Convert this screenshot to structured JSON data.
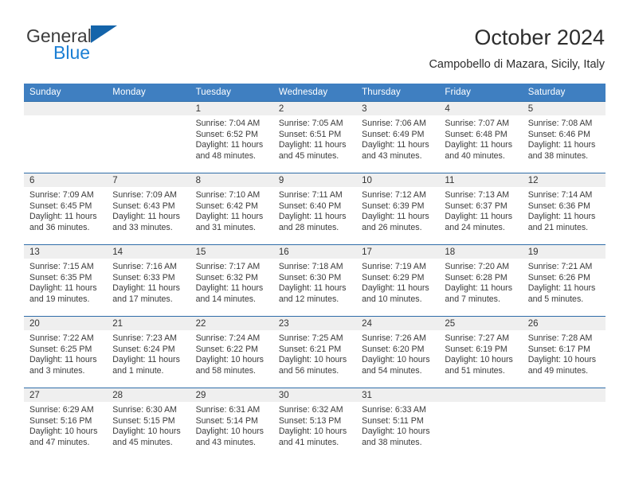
{
  "logo": {
    "name_top": "General",
    "name_bottom": "Blue",
    "triangle_color": "#1464aa",
    "blue_text_color": "#1b7fd4"
  },
  "header": {
    "title": "October 2024",
    "subtitle": "Campobello di Mazara, Sicily, Italy"
  },
  "colors": {
    "header_row": "#3f7fc1",
    "row_border": "#2f6da8",
    "daynum_band": "#efefef",
    "text": "#3a3a3a"
  },
  "weekday_headers": [
    "Sunday",
    "Monday",
    "Tuesday",
    "Wednesday",
    "Thursday",
    "Friday",
    "Saturday"
  ],
  "labels": {
    "sunrise_prefix": "Sunrise:",
    "sunset_prefix": "Sunset:",
    "daylight_prefix": "Daylight:"
  },
  "weeks": [
    [
      {
        "day": "",
        "empty": true
      },
      {
        "day": "",
        "empty": true
      },
      {
        "day": "1",
        "sunrise": "Sunrise: 7:04 AM",
        "sunset": "Sunset: 6:52 PM",
        "daylight_1": "Daylight: 11 hours",
        "daylight_2": "and 48 minutes."
      },
      {
        "day": "2",
        "sunrise": "Sunrise: 7:05 AM",
        "sunset": "Sunset: 6:51 PM",
        "daylight_1": "Daylight: 11 hours",
        "daylight_2": "and 45 minutes."
      },
      {
        "day": "3",
        "sunrise": "Sunrise: 7:06 AM",
        "sunset": "Sunset: 6:49 PM",
        "daylight_1": "Daylight: 11 hours",
        "daylight_2": "and 43 minutes."
      },
      {
        "day": "4",
        "sunrise": "Sunrise: 7:07 AM",
        "sunset": "Sunset: 6:48 PM",
        "daylight_1": "Daylight: 11 hours",
        "daylight_2": "and 40 minutes."
      },
      {
        "day": "5",
        "sunrise": "Sunrise: 7:08 AM",
        "sunset": "Sunset: 6:46 PM",
        "daylight_1": "Daylight: 11 hours",
        "daylight_2": "and 38 minutes."
      }
    ],
    [
      {
        "day": "6",
        "sunrise": "Sunrise: 7:09 AM",
        "sunset": "Sunset: 6:45 PM",
        "daylight_1": "Daylight: 11 hours",
        "daylight_2": "and 36 minutes."
      },
      {
        "day": "7",
        "sunrise": "Sunrise: 7:09 AM",
        "sunset": "Sunset: 6:43 PM",
        "daylight_1": "Daylight: 11 hours",
        "daylight_2": "and 33 minutes."
      },
      {
        "day": "8",
        "sunrise": "Sunrise: 7:10 AM",
        "sunset": "Sunset: 6:42 PM",
        "daylight_1": "Daylight: 11 hours",
        "daylight_2": "and 31 minutes."
      },
      {
        "day": "9",
        "sunrise": "Sunrise: 7:11 AM",
        "sunset": "Sunset: 6:40 PM",
        "daylight_1": "Daylight: 11 hours",
        "daylight_2": "and 28 minutes."
      },
      {
        "day": "10",
        "sunrise": "Sunrise: 7:12 AM",
        "sunset": "Sunset: 6:39 PM",
        "daylight_1": "Daylight: 11 hours",
        "daylight_2": "and 26 minutes."
      },
      {
        "day": "11",
        "sunrise": "Sunrise: 7:13 AM",
        "sunset": "Sunset: 6:37 PM",
        "daylight_1": "Daylight: 11 hours",
        "daylight_2": "and 24 minutes."
      },
      {
        "day": "12",
        "sunrise": "Sunrise: 7:14 AM",
        "sunset": "Sunset: 6:36 PM",
        "daylight_1": "Daylight: 11 hours",
        "daylight_2": "and 21 minutes."
      }
    ],
    [
      {
        "day": "13",
        "sunrise": "Sunrise: 7:15 AM",
        "sunset": "Sunset: 6:35 PM",
        "daylight_1": "Daylight: 11 hours",
        "daylight_2": "and 19 minutes."
      },
      {
        "day": "14",
        "sunrise": "Sunrise: 7:16 AM",
        "sunset": "Sunset: 6:33 PM",
        "daylight_1": "Daylight: 11 hours",
        "daylight_2": "and 17 minutes."
      },
      {
        "day": "15",
        "sunrise": "Sunrise: 7:17 AM",
        "sunset": "Sunset: 6:32 PM",
        "daylight_1": "Daylight: 11 hours",
        "daylight_2": "and 14 minutes."
      },
      {
        "day": "16",
        "sunrise": "Sunrise: 7:18 AM",
        "sunset": "Sunset: 6:30 PM",
        "daylight_1": "Daylight: 11 hours",
        "daylight_2": "and 12 minutes."
      },
      {
        "day": "17",
        "sunrise": "Sunrise: 7:19 AM",
        "sunset": "Sunset: 6:29 PM",
        "daylight_1": "Daylight: 11 hours",
        "daylight_2": "and 10 minutes."
      },
      {
        "day": "18",
        "sunrise": "Sunrise: 7:20 AM",
        "sunset": "Sunset: 6:28 PM",
        "daylight_1": "Daylight: 11 hours",
        "daylight_2": "and 7 minutes."
      },
      {
        "day": "19",
        "sunrise": "Sunrise: 7:21 AM",
        "sunset": "Sunset: 6:26 PM",
        "daylight_1": "Daylight: 11 hours",
        "daylight_2": "and 5 minutes."
      }
    ],
    [
      {
        "day": "20",
        "sunrise": "Sunrise: 7:22 AM",
        "sunset": "Sunset: 6:25 PM",
        "daylight_1": "Daylight: 11 hours",
        "daylight_2": "and 3 minutes."
      },
      {
        "day": "21",
        "sunrise": "Sunrise: 7:23 AM",
        "sunset": "Sunset: 6:24 PM",
        "daylight_1": "Daylight: 11 hours",
        "daylight_2": "and 1 minute."
      },
      {
        "day": "22",
        "sunrise": "Sunrise: 7:24 AM",
        "sunset": "Sunset: 6:22 PM",
        "daylight_1": "Daylight: 10 hours",
        "daylight_2": "and 58 minutes."
      },
      {
        "day": "23",
        "sunrise": "Sunrise: 7:25 AM",
        "sunset": "Sunset: 6:21 PM",
        "daylight_1": "Daylight: 10 hours",
        "daylight_2": "and 56 minutes."
      },
      {
        "day": "24",
        "sunrise": "Sunrise: 7:26 AM",
        "sunset": "Sunset: 6:20 PM",
        "daylight_1": "Daylight: 10 hours",
        "daylight_2": "and 54 minutes."
      },
      {
        "day": "25",
        "sunrise": "Sunrise: 7:27 AM",
        "sunset": "Sunset: 6:19 PM",
        "daylight_1": "Daylight: 10 hours",
        "daylight_2": "and 51 minutes."
      },
      {
        "day": "26",
        "sunrise": "Sunrise: 7:28 AM",
        "sunset": "Sunset: 6:17 PM",
        "daylight_1": "Daylight: 10 hours",
        "daylight_2": "and 49 minutes."
      }
    ],
    [
      {
        "day": "27",
        "sunrise": "Sunrise: 6:29 AM",
        "sunset": "Sunset: 5:16 PM",
        "daylight_1": "Daylight: 10 hours",
        "daylight_2": "and 47 minutes."
      },
      {
        "day": "28",
        "sunrise": "Sunrise: 6:30 AM",
        "sunset": "Sunset: 5:15 PM",
        "daylight_1": "Daylight: 10 hours",
        "daylight_2": "and 45 minutes."
      },
      {
        "day": "29",
        "sunrise": "Sunrise: 6:31 AM",
        "sunset": "Sunset: 5:14 PM",
        "daylight_1": "Daylight: 10 hours",
        "daylight_2": "and 43 minutes."
      },
      {
        "day": "30",
        "sunrise": "Sunrise: 6:32 AM",
        "sunset": "Sunset: 5:13 PM",
        "daylight_1": "Daylight: 10 hours",
        "daylight_2": "and 41 minutes."
      },
      {
        "day": "31",
        "sunrise": "Sunrise: 6:33 AM",
        "sunset": "Sunset: 5:11 PM",
        "daylight_1": "Daylight: 10 hours",
        "daylight_2": "and 38 minutes."
      },
      {
        "day": "",
        "empty": true
      },
      {
        "day": "",
        "empty": true
      }
    ]
  ]
}
